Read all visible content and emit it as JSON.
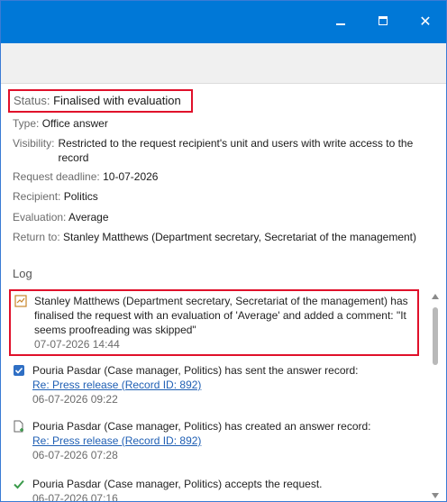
{
  "window": {
    "minimize_glyph": "minimize-icon",
    "maximize_glyph": "maximize-icon",
    "close_label": "✕"
  },
  "details": {
    "status_label": "Status:",
    "status_value": "Finalised with evaluation",
    "type_label": "Type:",
    "type_value": "Office answer",
    "visibility_label": "Visibility:",
    "visibility_value": "Restricted to the request recipient's unit and users with write access to the record",
    "deadline_label": "Request deadline:",
    "deadline_value": "10-07-2026",
    "recipient_label": "Recipient:",
    "recipient_value": "Politics",
    "evaluation_label": "Evaluation:",
    "evaluation_value": "Average",
    "return_label": "Return to:",
    "return_value": "Stanley Matthews (Department secretary, Secretariat of the management)"
  },
  "log": {
    "title": "Log",
    "entries": [
      {
        "icon": "comment-evaluation-icon",
        "text": "Stanley Matthews (Department secretary, Secretariat of the management) has finalised the request with an evaluation of 'Average' and added a comment: \"It seems proofreading was skipped\"",
        "link": "",
        "time": "07-07-2026 14:44"
      },
      {
        "icon": "checkbox-checked-icon",
        "text": "Pouria Pasdar (Case manager, Politics) has sent the answer record:",
        "link": "Re: Press release (Record ID: 892)",
        "time": "06-07-2026 09:22"
      },
      {
        "icon": "new-document-icon",
        "text": "Pouria Pasdar (Case manager, Politics) has created an answer record:",
        "link": "Re: Press release (Record ID: 892)",
        "time": "06-07-2026 07:28"
      },
      {
        "icon": "checkmark-icon",
        "text": "Pouria Pasdar (Case manager, Politics) accepts the request.",
        "link": "",
        "time": "06-07-2026 07:16"
      }
    ]
  },
  "colors": {
    "titlebar": "#0078d7",
    "highlight": "#e0102a",
    "link": "#1f5fb4",
    "check_green": "#3a9a4a"
  }
}
